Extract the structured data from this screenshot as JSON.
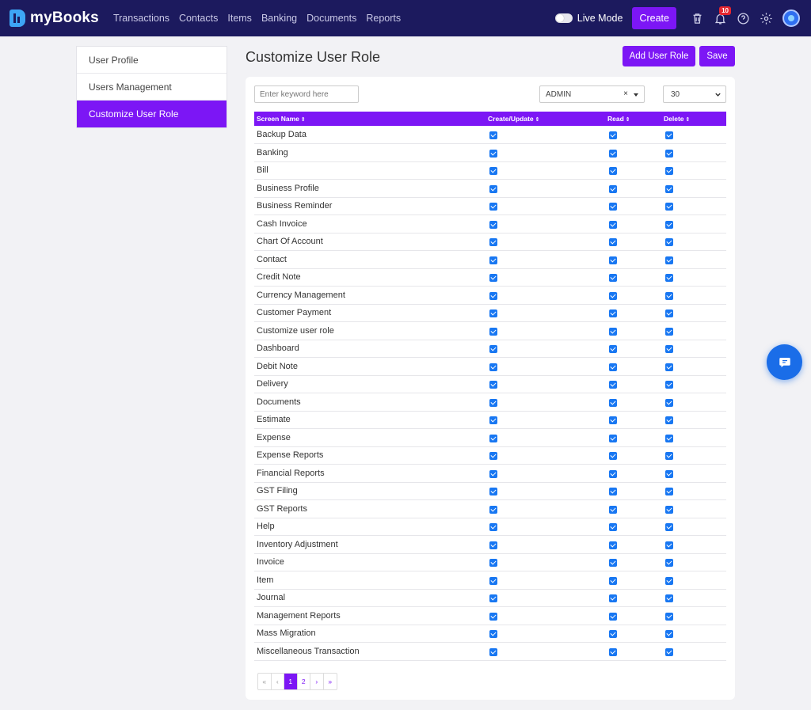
{
  "app": {
    "name": "myBooks"
  },
  "nav": [
    "Transactions",
    "Contacts",
    "Items",
    "Banking",
    "Documents",
    "Reports"
  ],
  "toolbar": {
    "live_mode_label": "Live Mode",
    "create_label": "Create",
    "notification_count": "10"
  },
  "sidebar": {
    "items": [
      "User Profile",
      "Users Management",
      "Customize User Role"
    ],
    "active_index": 2
  },
  "page": {
    "title": "Customize User Role",
    "add_role_label": "Add User Role",
    "save_label": "Save"
  },
  "filters": {
    "search_placeholder": "Enter keyword here",
    "role_value": "ADMIN",
    "role_clear": "×",
    "page_size": "30"
  },
  "table": {
    "columns": [
      "Screen Name",
      "Create/Update",
      "Read",
      "Delete"
    ],
    "sort_glyph": "⇕",
    "rows": [
      "Backup Data",
      "Banking",
      "Bill",
      "Business Profile",
      "Business Reminder",
      "Cash Invoice",
      "Chart Of Account",
      "Contact",
      "Credit Note",
      "Currency Management",
      "Customer Payment",
      "Customize user role",
      "Dashboard",
      "Debit Note",
      "Delivery",
      "Documents",
      "Estimate",
      "Expense",
      "Expense Reports",
      "Financial Reports",
      "GST Filing",
      "GST Reports",
      "Help",
      "Inventory Adjustment",
      "Invoice",
      "Item",
      "Journal",
      "Management Reports",
      "Mass Migration",
      "Miscellaneous Transaction"
    ],
    "all_checked": true
  },
  "pagination": {
    "first": "«",
    "prev": "‹",
    "pages": [
      "1",
      "2"
    ],
    "active_page": "1",
    "next": "›",
    "last": "»"
  },
  "colors": {
    "nav_bg": "#1c1a5e",
    "accent": "#7c16f5",
    "checkbox": "#1877f2",
    "chat": "#1a6de8"
  },
  "icons": [
    "trash-icon",
    "bell-icon",
    "help-icon",
    "gear-icon",
    "chat-icon",
    "chevron-down-icon"
  ]
}
